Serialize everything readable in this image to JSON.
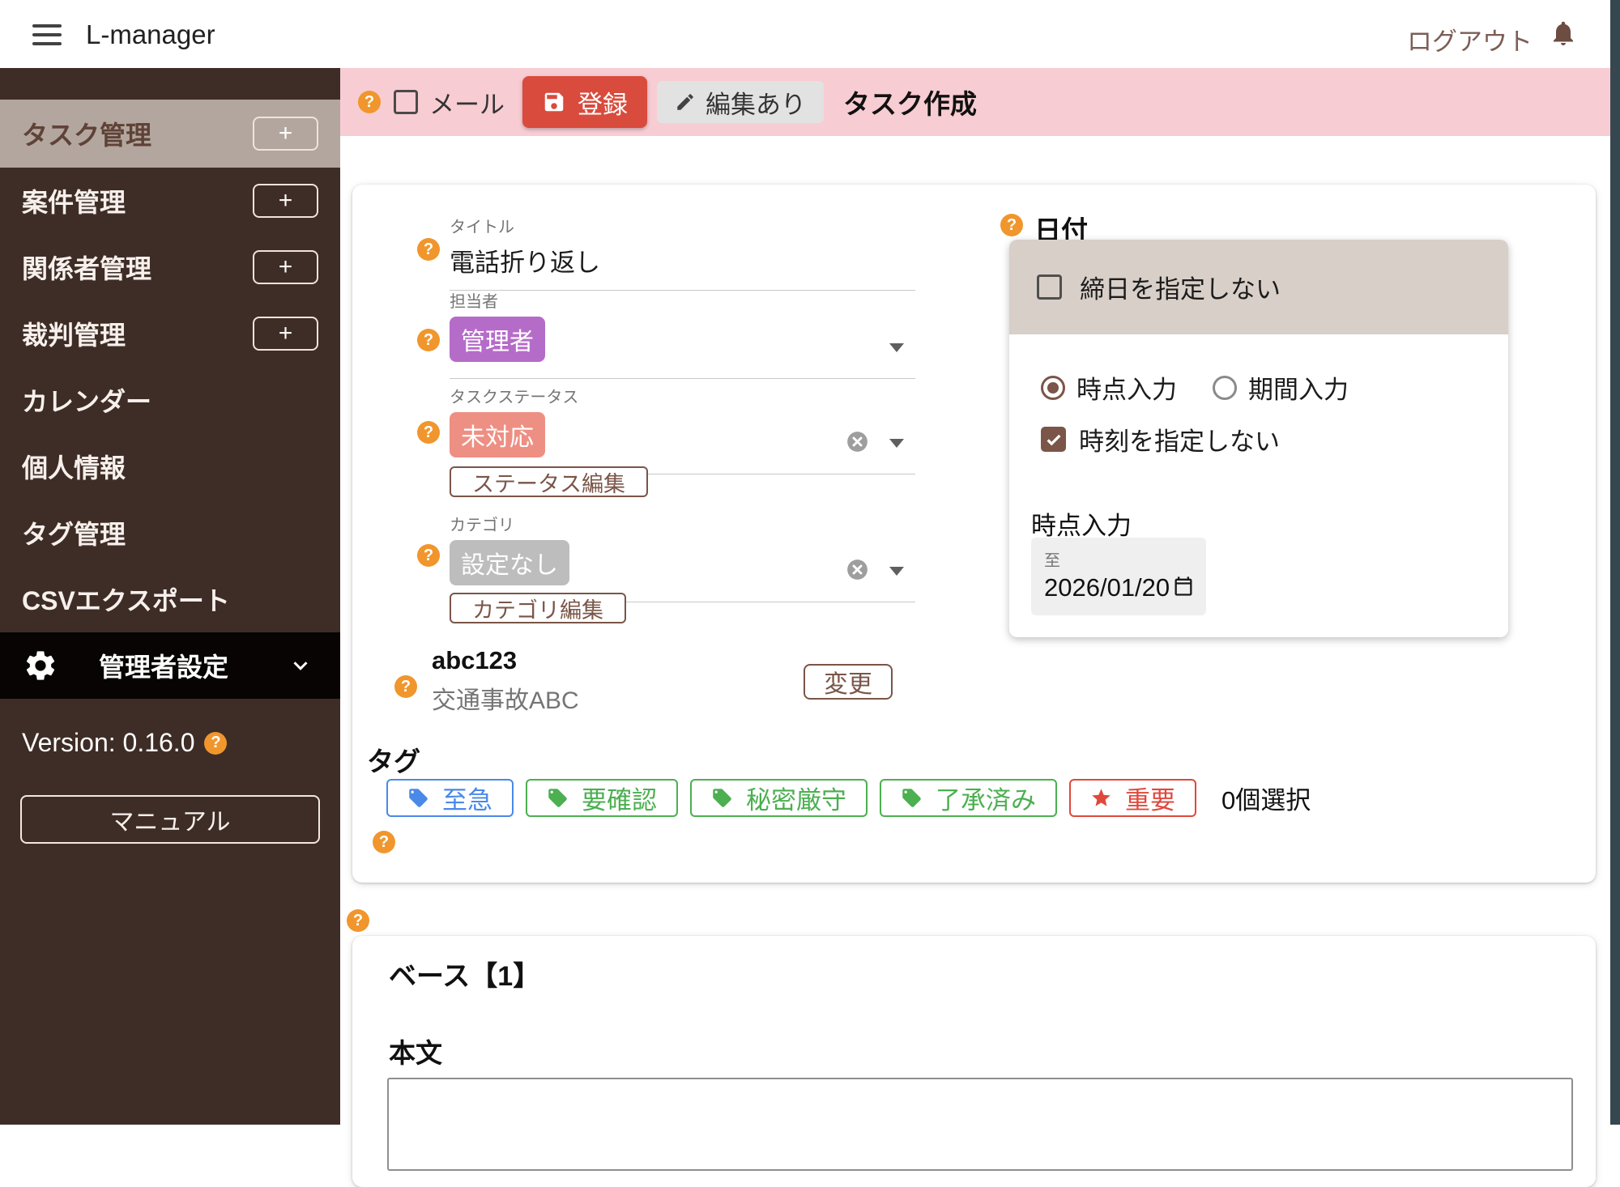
{
  "header": {
    "title": "L-manager",
    "logout_label": "ログアウト"
  },
  "sidebar": {
    "add_label": "+",
    "items": [
      {
        "label": "タスク管理",
        "active": true,
        "has_add": true
      },
      {
        "label": "案件管理",
        "has_add": true
      },
      {
        "label": "関係者管理",
        "has_add": true
      },
      {
        "label": "裁判管理",
        "has_add": true
      },
      {
        "label": "カレンダー"
      },
      {
        "label": "個人情報"
      },
      {
        "label": "タグ管理"
      },
      {
        "label": "CSVエクスポート"
      }
    ],
    "admin_label": "管理者設定",
    "version_label": "Version: 0.16.0",
    "manual_button": "マニュアル"
  },
  "toolbar": {
    "mail_label": "メール",
    "save_label": "登録",
    "edited_label": "編集あり",
    "page_title": "タスク作成"
  },
  "form": {
    "title": {
      "label": "タイトル",
      "value": "電話折り返し"
    },
    "assignee": {
      "label": "担当者",
      "chip": "管理者",
      "chip_color": "#b56cc8"
    },
    "status": {
      "label": "タスクステータス",
      "chip": "未対応",
      "chip_color": "#ee8f83",
      "edit_button": "ステータス編集"
    },
    "category": {
      "label": "カテゴリ",
      "chip": "設定なし",
      "chip_color": "#bdbdbd",
      "edit_button": "カテゴリ編集"
    },
    "case": {
      "code": "abc123",
      "name": "交通事故ABC",
      "change_button": "変更"
    }
  },
  "date_panel": {
    "heading": "日付",
    "no_due_checkbox": "締日を指定しない",
    "radio_point": "時点入力",
    "radio_period": "期間入力",
    "no_time_checkbox": "時刻を指定しない",
    "point_section": "時点入力",
    "date_field": {
      "label": "至",
      "value": "2026/01/20"
    }
  },
  "tags": {
    "heading": "タグ",
    "items": [
      {
        "label": "至急",
        "color": "#4a89e8",
        "icon": "tag"
      },
      {
        "label": "要確認",
        "color": "#4caf50",
        "icon": "tag"
      },
      {
        "label": "秘密厳守",
        "color": "#4caf50",
        "icon": "tag"
      },
      {
        "label": "了承済み",
        "color": "#4caf50",
        "icon": "tag"
      },
      {
        "label": "重要",
        "color": "#e0483c",
        "icon": "star"
      }
    ],
    "selected_count": "0個選択"
  },
  "base_section": {
    "heading": "ベース【1】",
    "body_label": "本文"
  },
  "help_icon": "?",
  "colors": {
    "accent_red": "#d94b3c",
    "toolbar_pink": "#f8ccd3",
    "sidebar_brown": "#3e2d26",
    "active_item": "#b3a69e",
    "brown_outline": "#7a5548",
    "help_orange": "#f0962d",
    "panel_header_beige": "#d8cfc8"
  }
}
